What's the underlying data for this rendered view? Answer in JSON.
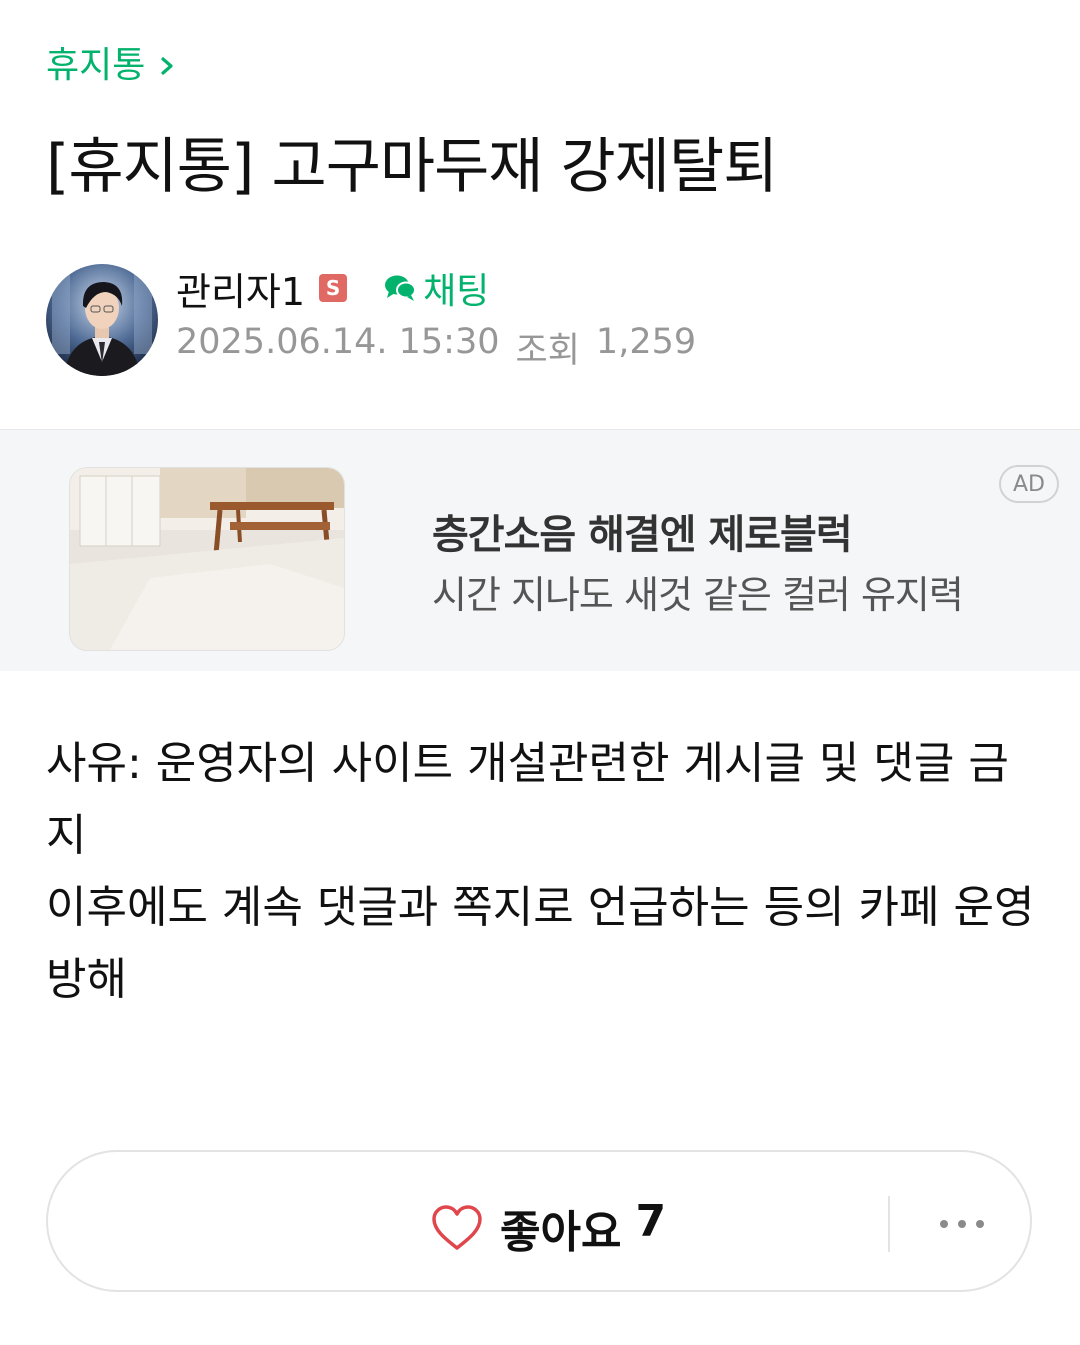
{
  "board": {
    "name": "휴지통"
  },
  "post": {
    "title": "[휴지통] 고구마두재 강제탈퇴",
    "author": {
      "name": "관리자1",
      "badge": "S",
      "chat_label": "채팅"
    },
    "date": "2025.06.14. 15:30",
    "views_label": "조회",
    "views": "1,259",
    "body": [
      "사유: 운영자의 사이트 개설관련한 게시글 및 댓글 금지",
      "이후에도 계속 댓글과 쪽지로 언급하는 등의 카페 운영 방해"
    ]
  },
  "ad": {
    "headline": "층간소음 해결엔 제로블럭",
    "subtext": "시간 지나도 새것 같은 컬러 유지력",
    "badge": "AD"
  },
  "actions": {
    "like_label": "좋아요",
    "like_count": "7"
  },
  "colors": {
    "accent_green": "#03b26c",
    "badge_red": "#e06a63",
    "meta_gray": "#979797"
  },
  "icons": {
    "board_chevron": "chevron-right-icon",
    "chat": "chat-bubbles-icon",
    "like": "heart-icon",
    "more": "more-horizontal-icon"
  }
}
